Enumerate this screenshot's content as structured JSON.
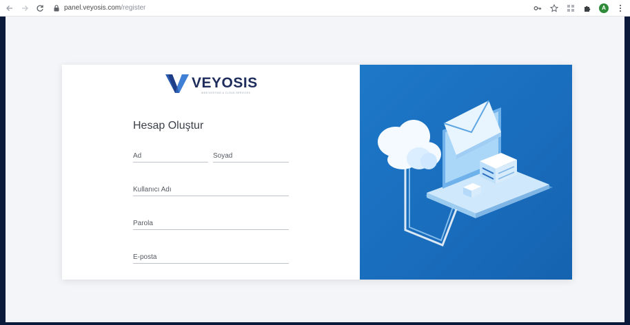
{
  "browser": {
    "url_host": "panel.veyosis.com",
    "url_path": "/register",
    "profile_initial": "A"
  },
  "icons": {
    "back": "arrow-left-icon",
    "forward": "arrow-right-icon",
    "reload": "reload-icon",
    "lock": "lock-icon",
    "key": "key-icon",
    "star": "star-icon",
    "extensions": "puzzle-icon",
    "menu": "kebab-menu-icon"
  },
  "brand": {
    "name": "VEYOSIS",
    "tagline": "WEB HOSTING & CLOUD SERVICES",
    "primary_color": "#1f2d5c",
    "accent_color": "#1e78c8"
  },
  "form": {
    "title": "Hesap Oluştur",
    "first_name_placeholder": "Ad",
    "last_name_placeholder": "Soyad",
    "username_placeholder": "Kullanıcı Adı",
    "password_placeholder": "Parola",
    "email_placeholder": "E-posta"
  }
}
